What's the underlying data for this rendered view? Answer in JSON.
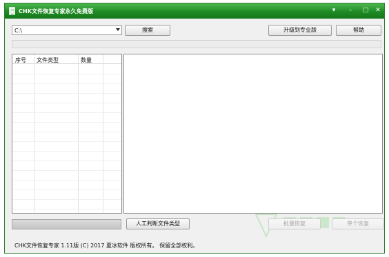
{
  "window": {
    "title": "CHK文件恢复专家永久免费版",
    "title_bar_color": "#1f8a24",
    "controls": {
      "menu_icon": "dropdown-arrow-icon",
      "minimize_icon": "minimize-icon",
      "maximize_icon": "maximize-icon",
      "close_icon": "close-icon"
    }
  },
  "toolbar": {
    "drive_select_value": "C:\\",
    "search_label": "搜索",
    "upgrade_label": "升级到专业版",
    "help_label": "帮助"
  },
  "file_types_table": {
    "columns": [
      "序号",
      "文件类型",
      "数量"
    ],
    "rows": []
  },
  "bottom_bar": {
    "manual_judge_label": "人工判断文件类型",
    "batch_recover_label": "批量恢复",
    "single_recover_label": "单个恢复"
  },
  "status": {
    "text": "CHK文件恢复专家 1.11版 (C) 2017 夏冰软件 版权所有。 保留全部权利。"
  }
}
